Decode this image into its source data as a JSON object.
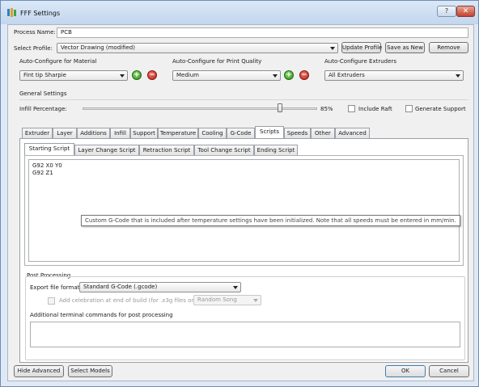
{
  "window": {
    "title": "FFF Settings",
    "help_glyph": "?",
    "close_glyph": "✕"
  },
  "process": {
    "label": "Process Name:",
    "value": "PCB"
  },
  "profile": {
    "label": "Select Profile:",
    "value": "Vector Drawing (modified)",
    "update_label": "Update Profile",
    "save_as_new_label": "Save as New",
    "remove_label": "Remove"
  },
  "auto_configure": {
    "material": {
      "label": "Auto-Configure for Material",
      "value": "Fint tip Sharpie"
    },
    "quality": {
      "label": "Auto-Configure for Print Quality",
      "value": "Medium"
    },
    "extruders": {
      "label": "Auto-Configure Extruders",
      "value": "All Extruders"
    },
    "plus_glyph": "+",
    "minus_glyph": "−"
  },
  "general_settings": {
    "heading": "General Settings",
    "infill_label": "Infill Percentage:",
    "infill_value_text": "85%",
    "infill_fraction": 0.85,
    "include_raft_label": "Include Raft",
    "generate_support_label": "Generate Support"
  },
  "main_tabs": [
    "Extruder",
    "Layer",
    "Additions",
    "Infill",
    "Support",
    "Temperature",
    "Cooling",
    "G-Code",
    "Scripts",
    "Speeds",
    "Other",
    "Advanced"
  ],
  "main_tabs_active": "Scripts",
  "script_tabs": [
    "Starting Script",
    "Layer Change Script",
    "Retraction Script",
    "Tool Change Script",
    "Ending Script"
  ],
  "script_tabs_active": "Starting Script",
  "starting_script": "G92 X0 Y0\nG92 Z1",
  "tooltip": "Custom G-Code that is included after temperature settings have been initialized.  Note that all speeds must be entered in mm/min.",
  "post_processing": {
    "heading": "Post Processing",
    "export_label": "Export file format",
    "export_value": "Standard G-Code (.gcode)",
    "celebration_label": "Add celebration at end of build (for .x3g files only)",
    "celebration_value": "Random Song",
    "terminal_label": "Additional terminal commands for post processing",
    "terminal_value": ""
  },
  "footer": {
    "hide_advanced_label": "Hide Advanced",
    "select_models_label": "Select Models",
    "ok_label": "OK",
    "cancel_label": "Cancel"
  }
}
